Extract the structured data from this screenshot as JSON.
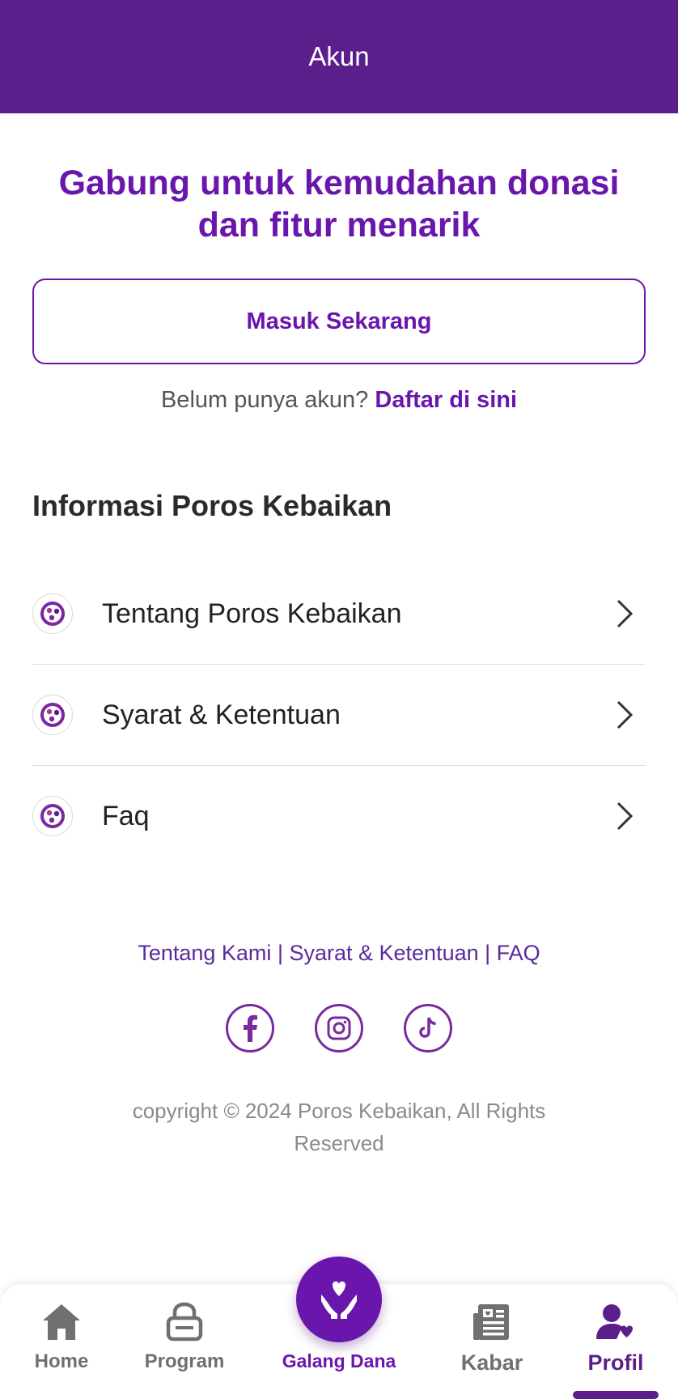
{
  "header": {
    "title": "Akun"
  },
  "hero": {
    "title": "Gabung untuk kemudahan donasi dan fitur menarik",
    "login_label": "Masuk Sekarang",
    "signup_prompt": "Belum punya akun?",
    "signup_link": "Daftar di sini"
  },
  "info": {
    "section_title": "Informasi Poros Kebaikan",
    "items": [
      {
        "label": "Tentang Poros Kebaikan",
        "icon": "poros-logo-icon"
      },
      {
        "label": "Syarat & Ketentuan",
        "icon": "poros-logo-icon"
      },
      {
        "label": "Faq",
        "icon": "poros-logo-icon"
      }
    ]
  },
  "footer": {
    "links": [
      "Tentang Kami",
      "Syarat & Ketentuan",
      "FAQ"
    ],
    "separator": "|",
    "socials": [
      "facebook-icon",
      "instagram-icon",
      "tiktok-icon"
    ],
    "copyright": "copyright © 2024 Poros Kebaikan, All Rights Reserved"
  },
  "nav": {
    "items": [
      {
        "label": "Home",
        "icon": "home-icon"
      },
      {
        "label": "Program",
        "icon": "program-icon"
      },
      {
        "label": "Galang Dana",
        "icon": "hands-heart-icon"
      },
      {
        "label": "Kabar",
        "icon": "news-icon"
      },
      {
        "label": "Profil",
        "icon": "profile-icon"
      }
    ],
    "active": "Profil"
  },
  "colors": {
    "header": "#5b1f8c",
    "accent": "#6a16ad",
    "nav_inactive": "#707070",
    "nav_active": "#5b1f8c"
  }
}
